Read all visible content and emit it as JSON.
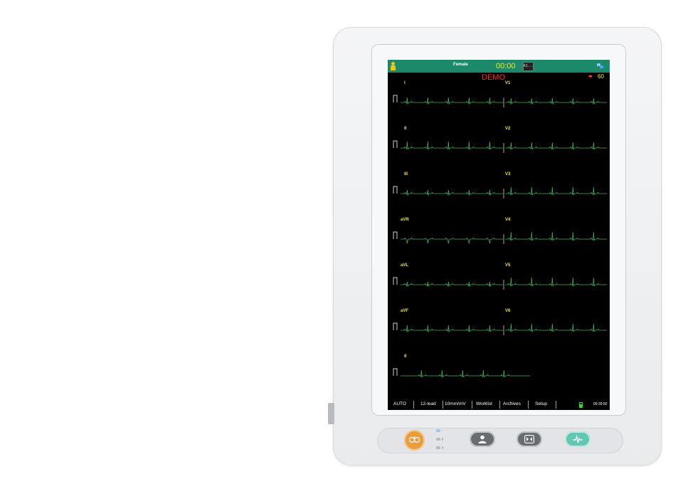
{
  "header": {
    "gender": "Female",
    "timer": "00:00",
    "rec_label": "K1...",
    "demo": "DEMO",
    "hr_value": "60"
  },
  "leads": [
    {
      "label": "I"
    },
    {
      "label": "II"
    },
    {
      "label": "III"
    },
    {
      "label": "aVR"
    },
    {
      "label": "aVL"
    },
    {
      "label": "aVF"
    },
    {
      "label": "V1"
    },
    {
      "label": "V2"
    },
    {
      "label": "V3"
    },
    {
      "label": "V4"
    },
    {
      "label": "V5"
    },
    {
      "label": "V6"
    },
    {
      "label": "II"
    }
  ],
  "menu": {
    "mode": "AUTO",
    "leads": "12-lead",
    "gain": "10mm/mV",
    "worklist": "Worklist",
    "archives": "Archives",
    "setup": "Setup"
  },
  "status": {
    "time": "09:39:50"
  },
  "colors": {
    "topbar": "#1c8a6a",
    "trace": "#3fae5a",
    "lead_label": "#f5e623",
    "demo": "#ff2a2a",
    "power": "#e99d3c",
    "ecg_key": "#62c7b2"
  },
  "keys": {
    "power": "power-standby-icon",
    "patient": "patient-icon",
    "print": "start-stop-icon",
    "ecg": "ecg-wave-icon"
  }
}
